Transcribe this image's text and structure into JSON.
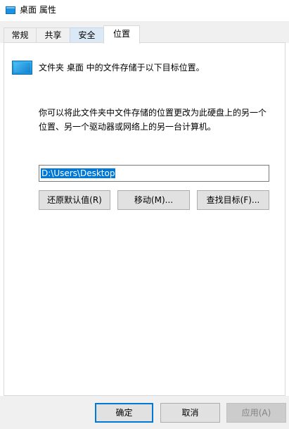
{
  "window": {
    "title": "桌面 属性",
    "icon": "folder-icon"
  },
  "tabs": [
    {
      "label": "常规",
      "state": "normal"
    },
    {
      "label": "共享",
      "state": "normal"
    },
    {
      "label": "安全",
      "state": "hover"
    },
    {
      "label": "位置",
      "state": "active"
    }
  ],
  "location": {
    "header": "文件夹 桌面 中的文件存储于以下目标位置。",
    "description_line1": "你可以将此文件夹中文件存储的位置更改为此硬盘上的另一个",
    "description_line2": "位置、另一个驱动器或网络上的另一台计算机。",
    "path_value": "D:\\Users\\Desktop",
    "restore_default_label": "还原默认值(R)",
    "move_label": "移动(M)...",
    "find_target_label": "查找目标(F)..."
  },
  "footer": {
    "ok_label": "确定",
    "cancel_label": "取消",
    "apply_label": "应用(A)"
  },
  "colors": {
    "accent": "#0078d7",
    "folder_blue": "#1e90e0",
    "tab_hover": "#dbe9f6"
  }
}
